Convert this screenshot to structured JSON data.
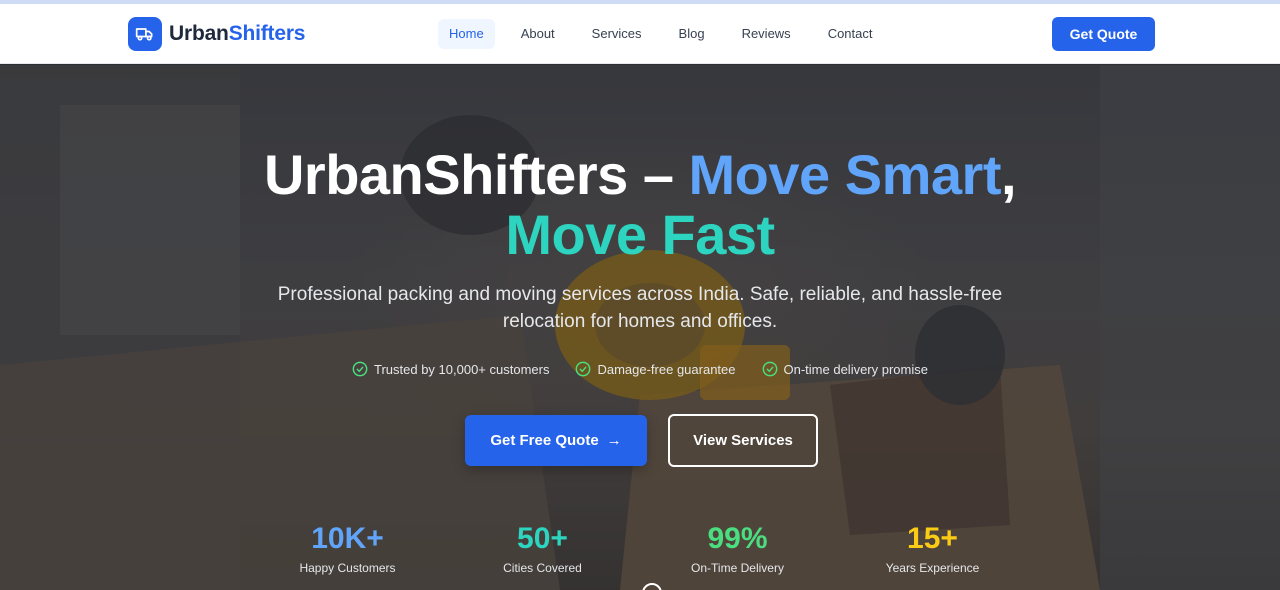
{
  "brand": {
    "name_part1": "Urban",
    "name_part2": "Shifters",
    "color": "#2563eb"
  },
  "nav": {
    "items": [
      {
        "label": "Home",
        "active": true
      },
      {
        "label": "About"
      },
      {
        "label": "Services"
      },
      {
        "label": "Blog"
      },
      {
        "label": "Reviews"
      },
      {
        "label": "Contact"
      }
    ],
    "cta_label": "Get Quote"
  },
  "hero": {
    "title_part1": "UrbanShifters –",
    "title_part2": "Move Smart",
    "title_part3": ",",
    "title_part4": "Move Fast",
    "subtitle": "Professional packing and moving services across India. Safe, reliable, and hassle-free relocation for homes and offices.",
    "features": [
      {
        "icon": "check-circle-icon",
        "label": "Trusted by 10,000+ customers"
      },
      {
        "icon": "check-circle-icon",
        "label": "Damage-free guarantee"
      },
      {
        "icon": "check-circle-icon",
        "label": "On-time delivery promise"
      }
    ],
    "primary_cta": "Get Free Quote",
    "secondary_cta": "View Services",
    "title_colors": {
      "accent_blue": "#60a5fa",
      "accent_teal": "#2dd4bf"
    }
  },
  "stats": [
    {
      "value": "10K+",
      "label": "Happy Customers",
      "color": "#60a5fa"
    },
    {
      "value": "50+",
      "label": "Cities Covered",
      "color": "#2dd4bf"
    },
    {
      "value": "99%",
      "label": "On-Time Delivery",
      "color": "#4ade80"
    },
    {
      "value": "15+",
      "label": "Years Experience",
      "color": "#facc15"
    }
  ]
}
